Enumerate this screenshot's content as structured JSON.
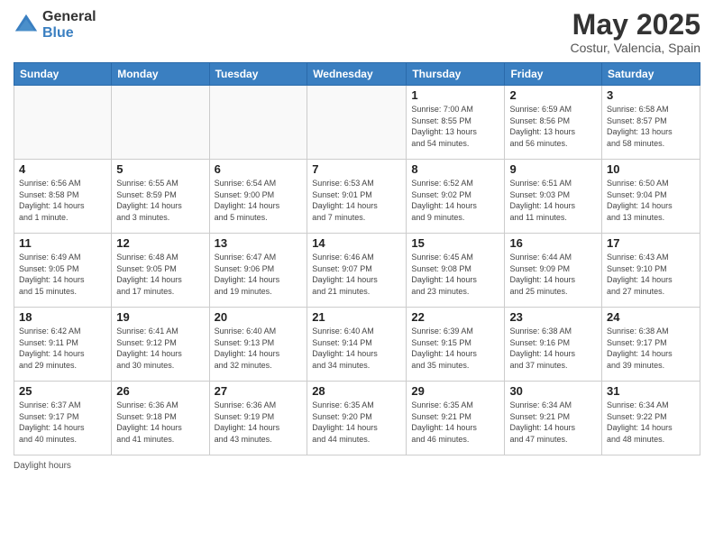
{
  "logo": {
    "general": "General",
    "blue": "Blue"
  },
  "title": "May 2025",
  "subtitle": "Costur, Valencia, Spain",
  "days_header": [
    "Sunday",
    "Monday",
    "Tuesday",
    "Wednesday",
    "Thursday",
    "Friday",
    "Saturday"
  ],
  "weeks": [
    [
      {
        "day": "",
        "info": ""
      },
      {
        "day": "",
        "info": ""
      },
      {
        "day": "",
        "info": ""
      },
      {
        "day": "",
        "info": ""
      },
      {
        "day": "1",
        "info": "Sunrise: 7:00 AM\nSunset: 8:55 PM\nDaylight: 13 hours\nand 54 minutes."
      },
      {
        "day": "2",
        "info": "Sunrise: 6:59 AM\nSunset: 8:56 PM\nDaylight: 13 hours\nand 56 minutes."
      },
      {
        "day": "3",
        "info": "Sunrise: 6:58 AM\nSunset: 8:57 PM\nDaylight: 13 hours\nand 58 minutes."
      }
    ],
    [
      {
        "day": "4",
        "info": "Sunrise: 6:56 AM\nSunset: 8:58 PM\nDaylight: 14 hours\nand 1 minute."
      },
      {
        "day": "5",
        "info": "Sunrise: 6:55 AM\nSunset: 8:59 PM\nDaylight: 14 hours\nand 3 minutes."
      },
      {
        "day": "6",
        "info": "Sunrise: 6:54 AM\nSunset: 9:00 PM\nDaylight: 14 hours\nand 5 minutes."
      },
      {
        "day": "7",
        "info": "Sunrise: 6:53 AM\nSunset: 9:01 PM\nDaylight: 14 hours\nand 7 minutes."
      },
      {
        "day": "8",
        "info": "Sunrise: 6:52 AM\nSunset: 9:02 PM\nDaylight: 14 hours\nand 9 minutes."
      },
      {
        "day": "9",
        "info": "Sunrise: 6:51 AM\nSunset: 9:03 PM\nDaylight: 14 hours\nand 11 minutes."
      },
      {
        "day": "10",
        "info": "Sunrise: 6:50 AM\nSunset: 9:04 PM\nDaylight: 14 hours\nand 13 minutes."
      }
    ],
    [
      {
        "day": "11",
        "info": "Sunrise: 6:49 AM\nSunset: 9:05 PM\nDaylight: 14 hours\nand 15 minutes."
      },
      {
        "day": "12",
        "info": "Sunrise: 6:48 AM\nSunset: 9:05 PM\nDaylight: 14 hours\nand 17 minutes."
      },
      {
        "day": "13",
        "info": "Sunrise: 6:47 AM\nSunset: 9:06 PM\nDaylight: 14 hours\nand 19 minutes."
      },
      {
        "day": "14",
        "info": "Sunrise: 6:46 AM\nSunset: 9:07 PM\nDaylight: 14 hours\nand 21 minutes."
      },
      {
        "day": "15",
        "info": "Sunrise: 6:45 AM\nSunset: 9:08 PM\nDaylight: 14 hours\nand 23 minutes."
      },
      {
        "day": "16",
        "info": "Sunrise: 6:44 AM\nSunset: 9:09 PM\nDaylight: 14 hours\nand 25 minutes."
      },
      {
        "day": "17",
        "info": "Sunrise: 6:43 AM\nSunset: 9:10 PM\nDaylight: 14 hours\nand 27 minutes."
      }
    ],
    [
      {
        "day": "18",
        "info": "Sunrise: 6:42 AM\nSunset: 9:11 PM\nDaylight: 14 hours\nand 29 minutes."
      },
      {
        "day": "19",
        "info": "Sunrise: 6:41 AM\nSunset: 9:12 PM\nDaylight: 14 hours\nand 30 minutes."
      },
      {
        "day": "20",
        "info": "Sunrise: 6:40 AM\nSunset: 9:13 PM\nDaylight: 14 hours\nand 32 minutes."
      },
      {
        "day": "21",
        "info": "Sunrise: 6:40 AM\nSunset: 9:14 PM\nDaylight: 14 hours\nand 34 minutes."
      },
      {
        "day": "22",
        "info": "Sunrise: 6:39 AM\nSunset: 9:15 PM\nDaylight: 14 hours\nand 35 minutes."
      },
      {
        "day": "23",
        "info": "Sunrise: 6:38 AM\nSunset: 9:16 PM\nDaylight: 14 hours\nand 37 minutes."
      },
      {
        "day": "24",
        "info": "Sunrise: 6:38 AM\nSunset: 9:17 PM\nDaylight: 14 hours\nand 39 minutes."
      }
    ],
    [
      {
        "day": "25",
        "info": "Sunrise: 6:37 AM\nSunset: 9:17 PM\nDaylight: 14 hours\nand 40 minutes."
      },
      {
        "day": "26",
        "info": "Sunrise: 6:36 AM\nSunset: 9:18 PM\nDaylight: 14 hours\nand 41 minutes."
      },
      {
        "day": "27",
        "info": "Sunrise: 6:36 AM\nSunset: 9:19 PM\nDaylight: 14 hours\nand 43 minutes."
      },
      {
        "day": "28",
        "info": "Sunrise: 6:35 AM\nSunset: 9:20 PM\nDaylight: 14 hours\nand 44 minutes."
      },
      {
        "day": "29",
        "info": "Sunrise: 6:35 AM\nSunset: 9:21 PM\nDaylight: 14 hours\nand 46 minutes."
      },
      {
        "day": "30",
        "info": "Sunrise: 6:34 AM\nSunset: 9:21 PM\nDaylight: 14 hours\nand 47 minutes."
      },
      {
        "day": "31",
        "info": "Sunrise: 6:34 AM\nSunset: 9:22 PM\nDaylight: 14 hours\nand 48 minutes."
      }
    ]
  ],
  "footer": {
    "daylight_hours": "Daylight hours"
  }
}
